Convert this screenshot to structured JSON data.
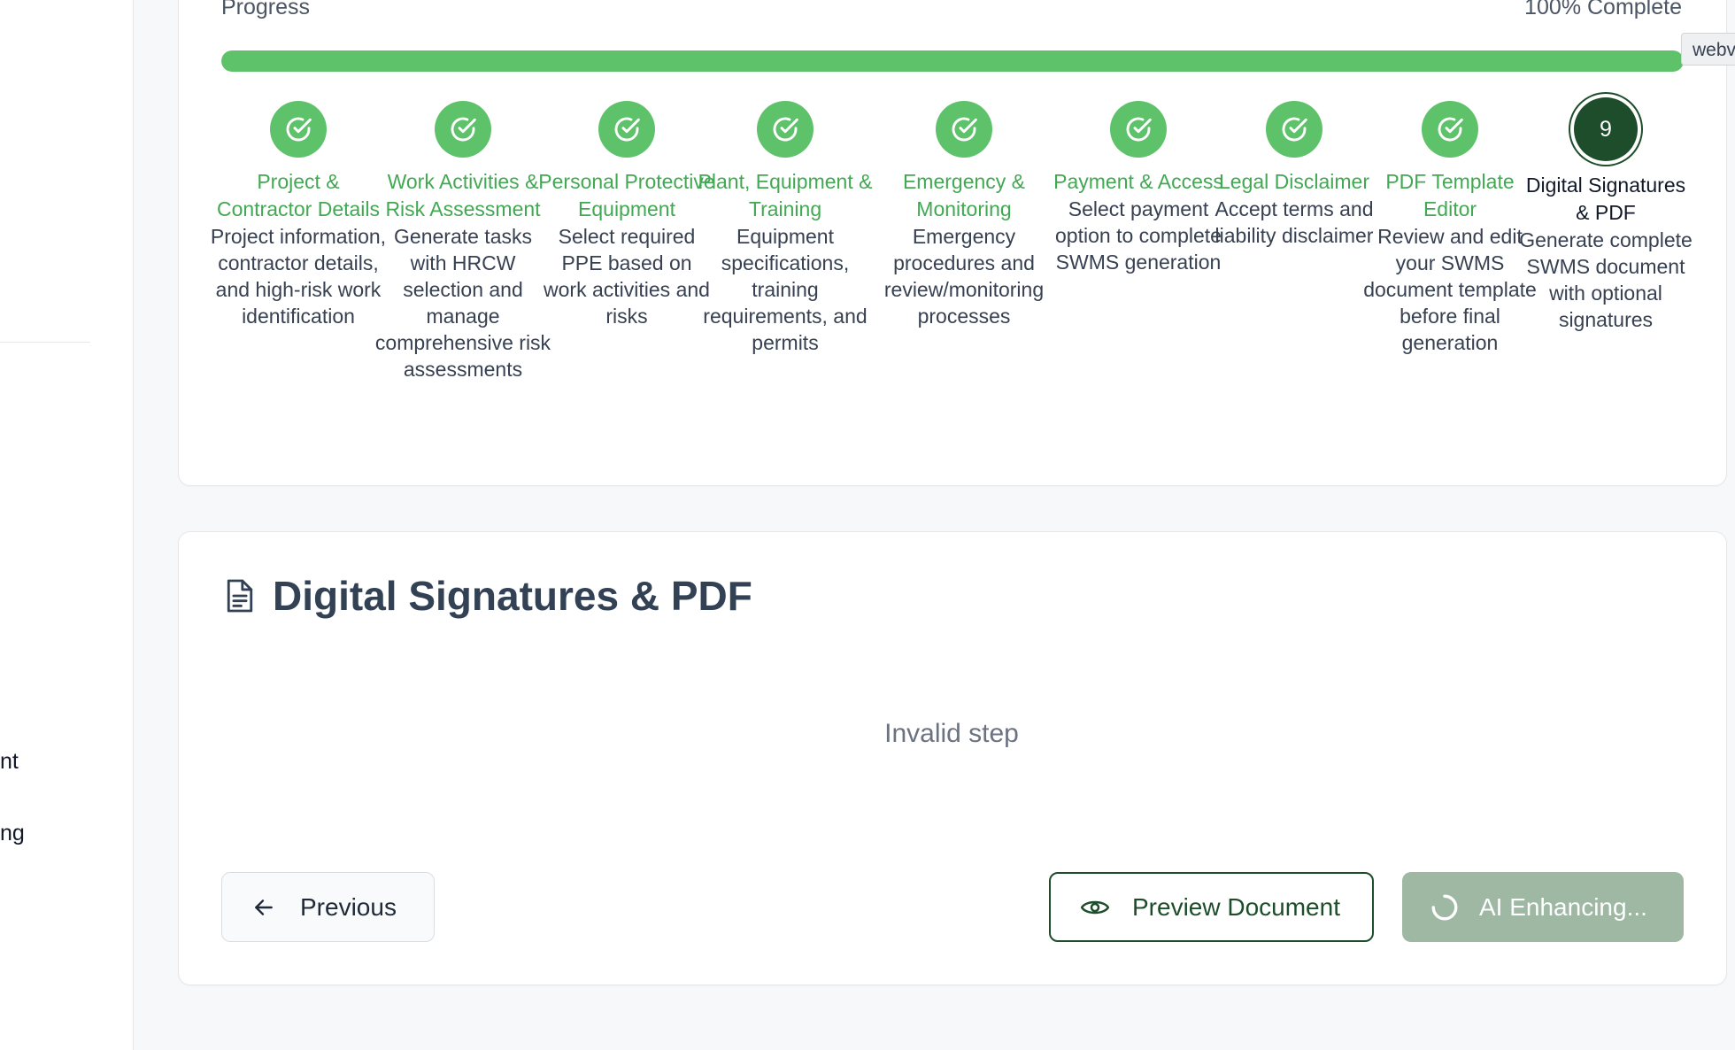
{
  "sidebar": {
    "items": [
      {
        "label": "nt"
      },
      {
        "label": "ng"
      }
    ]
  },
  "progress": {
    "label": "Progress",
    "percent_text": "100% Complete",
    "percent": 100,
    "fill_color": "#5ec26a",
    "tooltip": "webv"
  },
  "steps": [
    {
      "title": "Project & Contractor Details",
      "description": "Project information, contractor details, and high-risk work identification",
      "status": "completed",
      "icon": "check-circle-icon"
    },
    {
      "title": "Work Activities & Risk Assessment",
      "description": "Generate tasks with HRCW selection and manage comprehensive risk assessments",
      "status": "completed",
      "icon": "check-circle-icon"
    },
    {
      "title": "Personal Protective Equipment",
      "description": "Select required PPE based on work activities and risks",
      "status": "completed",
      "icon": "check-circle-icon"
    },
    {
      "title": "Plant, Equipment & Training",
      "description": "Equipment specifications, training requirements, and permits",
      "status": "completed",
      "icon": "check-circle-icon"
    },
    {
      "title": "Emergency & Monitoring",
      "description": "Emergency procedures and review/monitoring processes",
      "status": "completed",
      "icon": "check-circle-icon"
    },
    {
      "title": "Payment & Access",
      "description": "Select payment option to complete SWMS generation",
      "status": "completed",
      "icon": "check-circle-icon"
    },
    {
      "title": "Legal Disclaimer",
      "description": "Accept terms and liability disclaimer",
      "status": "completed",
      "icon": "check-circle-icon"
    },
    {
      "title": "PDF Template Editor",
      "description": "Review and edit your SWMS document template before final generation",
      "status": "completed",
      "icon": "check-circle-icon"
    },
    {
      "title": "Digital Signatures & PDF",
      "description": "Generate complete SWMS document with optional signatures",
      "status": "current",
      "number": "9"
    }
  ],
  "main": {
    "title": "Digital Signatures & PDF",
    "title_icon": "document-icon",
    "message": "Invalid step"
  },
  "actions": {
    "previous_label": "Previous",
    "preview_label": "Preview Document",
    "ai_label": "AI Enhancing..."
  },
  "colors": {
    "completed_green": "#5ec26a",
    "completed_text": "#42a853",
    "current_dark": "#1e4d2b",
    "ai_button_bg": "#9eb8a4"
  }
}
